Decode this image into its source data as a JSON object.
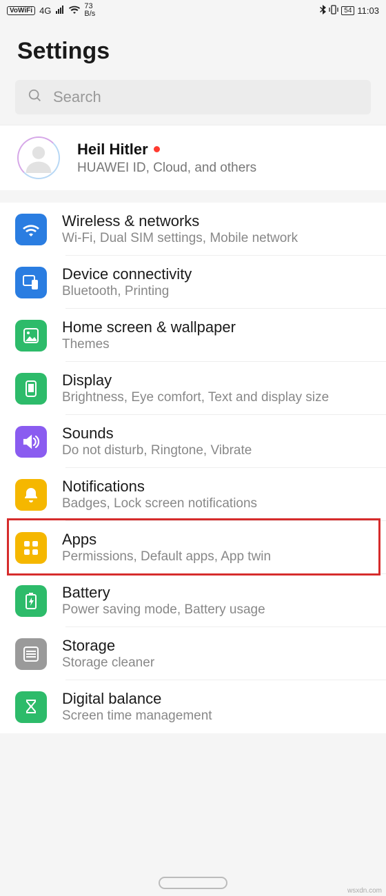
{
  "status": {
    "vowifi": "VoWiFi",
    "net": "4G",
    "speed_top": "73",
    "speed_bot": "B/s",
    "battery": "54",
    "time": "11:03"
  },
  "header": {
    "title": "Settings"
  },
  "search": {
    "placeholder": "Search"
  },
  "account": {
    "name": "Heil Hitler",
    "sub": "HUAWEI ID, Cloud, and others"
  },
  "items": [
    {
      "icon": "wifi-icon",
      "color": "c-blue",
      "label": "Wireless & networks",
      "sub": "Wi-Fi, Dual SIM settings, Mobile network"
    },
    {
      "icon": "devices-icon",
      "color": "c-blue2",
      "label": "Device connectivity",
      "sub": "Bluetooth, Printing"
    },
    {
      "icon": "wallpaper-icon",
      "color": "c-green",
      "label": "Home screen & wallpaper",
      "sub": "Themes"
    },
    {
      "icon": "display-icon",
      "color": "c-green2",
      "label": "Display",
      "sub": "Brightness, Eye comfort, Text and display size"
    },
    {
      "icon": "sound-icon",
      "color": "c-purple",
      "label": "Sounds",
      "sub": "Do not disturb, Ringtone, Vibrate"
    },
    {
      "icon": "bell-icon",
      "color": "c-amber",
      "label": "Notifications",
      "sub": "Badges, Lock screen notifications"
    },
    {
      "icon": "apps-icon",
      "color": "c-amber2",
      "label": "Apps",
      "sub": "Permissions, Default apps, App twin",
      "highlighted": true
    },
    {
      "icon": "battery-icon",
      "color": "c-green",
      "label": "Battery",
      "sub": "Power saving mode, Battery usage"
    },
    {
      "icon": "storage-icon",
      "color": "c-grey",
      "label": "Storage",
      "sub": "Storage cleaner"
    },
    {
      "icon": "hourglass-icon",
      "color": "c-green2",
      "label": "Digital balance",
      "sub": "Screen time management"
    }
  ],
  "watermark": "wsxdn.com"
}
